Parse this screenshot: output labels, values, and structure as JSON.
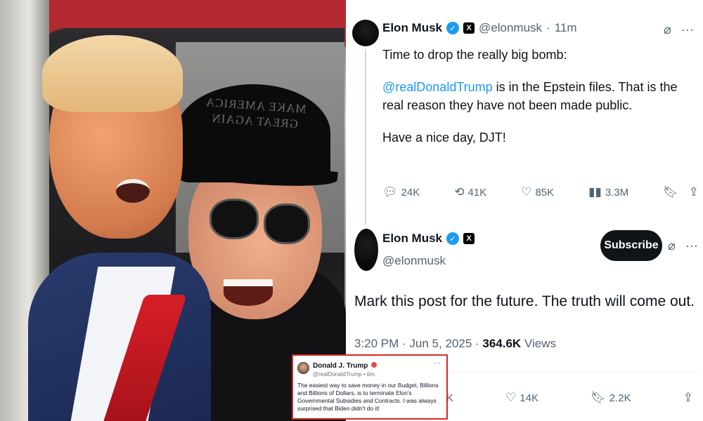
{
  "tweet1": {
    "author_name": "Elon Musk",
    "x_badge": "X",
    "handle": "@elonmusk",
    "separator": "·",
    "time": "11m",
    "line1": "Time to drop the really big bomb:",
    "mention": "@realDonaldTrump",
    "line2_rest": " is in the Epstein files. That is the real reason they have not been made public.",
    "line3": "Have a nice day, DJT!",
    "metrics": {
      "replies": "24K",
      "reposts": "41K",
      "likes": "85K",
      "views": "3.3M"
    }
  },
  "tweet2": {
    "author_name": "Elon Musk",
    "x_badge": "X",
    "handle": "@elonmusk",
    "subscribe_label": "Subscribe",
    "text": "Mark this post for the future. The truth will come out.",
    "time": "3:20 PM",
    "date": "Jun 5, 2025",
    "views_count": "364.6K",
    "views_label": "Views",
    "metrics": {
      "reposts": "1.4K",
      "likes": "14K",
      "bookmarks": "2.2K"
    }
  },
  "truth_post": {
    "author_name": "Donald J. Trump",
    "handle": "@realDonaldTrump",
    "separator": "•",
    "time": "6m",
    "text": "The easiest way to save money in our Budget, Billions and Billions of Dollars, is to terminate Elon's Governmental Subsidies and Contracts. I was always surprised that Biden didn't do it!"
  },
  "photo": {
    "cap_text": "MAKE AMERICA GREAT AGAIN"
  },
  "icons": {
    "grok": "grok-icon",
    "more": "more-icon",
    "reply": "reply-icon",
    "repost": "repost-icon",
    "like": "heart-icon",
    "views": "views-icon",
    "bookmark": "bookmark-icon",
    "share": "share-icon"
  },
  "colors": {
    "accent": "#1d9bf0",
    "text": "#0f1419",
    "muted": "#536471",
    "inset_border": "#d62828"
  }
}
